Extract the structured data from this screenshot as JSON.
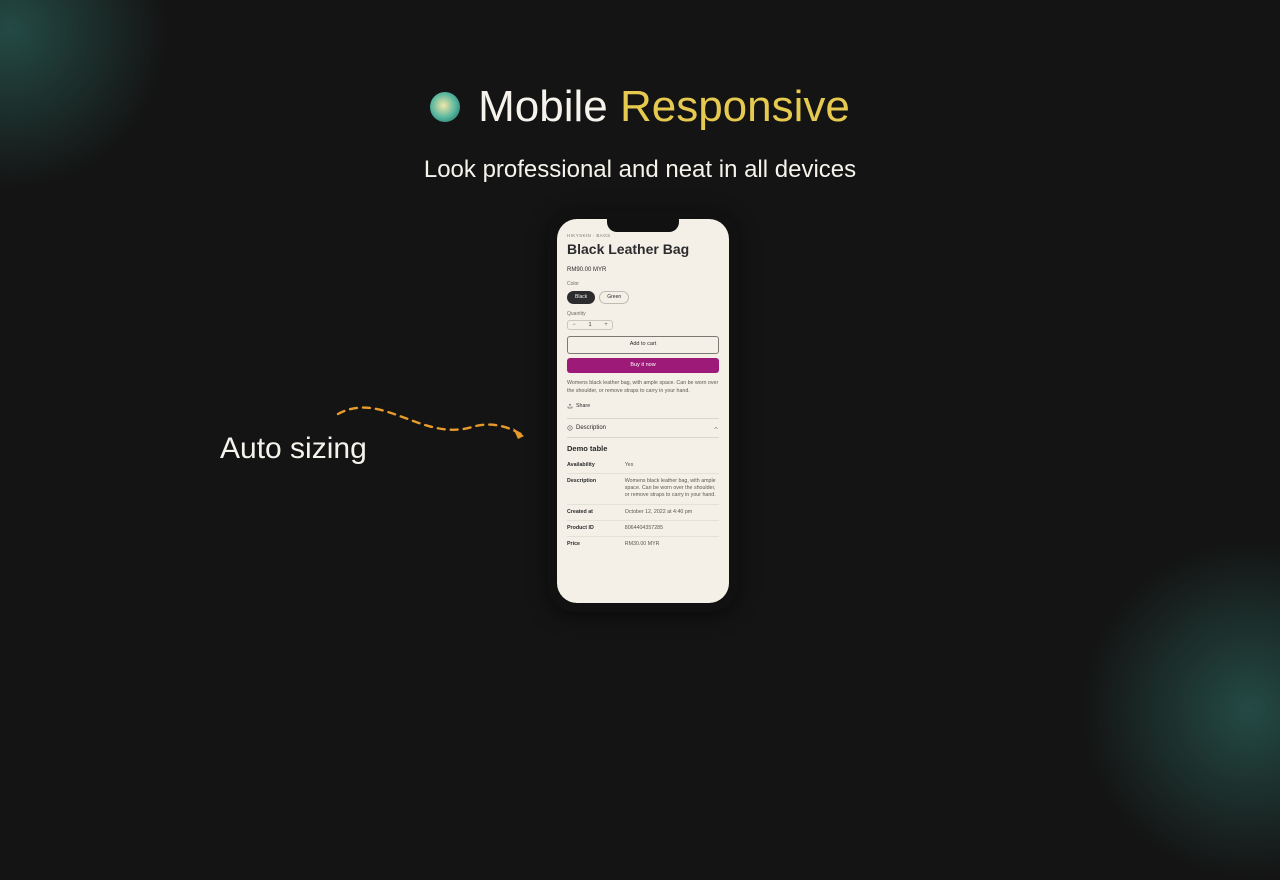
{
  "header": {
    "title_part1": "Mobile ",
    "title_part2": "Responsive",
    "subtitle": "Look professional and neat in all devices"
  },
  "callout": {
    "label": "Auto sizing"
  },
  "phone": {
    "breadcrumb": "HIKYSKIN · BAGS",
    "product_title": "Black Leather Bag",
    "price": "RM90.00 MYR",
    "color_label": "Color",
    "colors": [
      "Black",
      "Green"
    ],
    "quantity_label": "Quantity",
    "quantity_value": "1",
    "add_to_cart": "Add to cart",
    "buy_now": "Buy it now",
    "description": "Womens black leather bag, with ample space. Can be worn over the shoulder, or remove straps to carry in your hand.",
    "share_label": "Share",
    "accordion_label": "Description",
    "section_title": "Demo table",
    "table": [
      {
        "key": "Availability",
        "val": "Yes"
      },
      {
        "key": "Description",
        "val": "Womens black leather bag, with ample space. Can be worn over the shoulder, or remove straps to carry in your hand."
      },
      {
        "key": "Created at",
        "val": "October 12, 2022 at 4:40 pm"
      },
      {
        "key": "Product ID",
        "val": "8064404357285"
      },
      {
        "key": "Price",
        "val": "RM30.00 MYR"
      }
    ]
  }
}
